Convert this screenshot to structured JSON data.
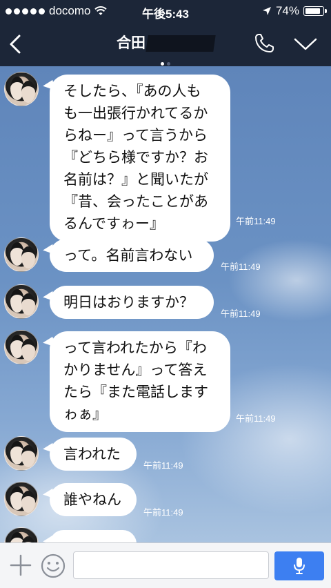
{
  "status_bar": {
    "carrier": "docomo",
    "time": "午後5:43",
    "battery": "74%",
    "battery_level": 0.74,
    "icons": [
      "signal-dots-icon",
      "wifi-icon",
      "location-arrow-icon",
      "battery-icon"
    ]
  },
  "header": {
    "title": "合田",
    "icons": [
      "back-chevron-icon",
      "phone-icon",
      "chevron-down-icon"
    ]
  },
  "messages": [
    {
      "text": "そしたら、『あの人もも一出張行かれてるからねー』って言うから『どちら様ですか？お名前は？』と聞いたが『昔、会ったことがあるんですゎー』",
      "lines": [
        "そしたら、『あの人も",
        "も一出張行かれてるか",
        "らねー』って言うから",
        "『どちら様ですか？お",
        "名前は？』と聞いたが",
        "『昔、会ったことがあ",
        "るんですゎー』"
      ],
      "time": "午前11:49"
    },
    {
      "text": "って。名前言わない",
      "lines": [
        "って。名前言わない"
      ],
      "time": "午前11:49"
    },
    {
      "text": "明日はおりますか？",
      "lines": [
        "明日はおりますか？"
      ],
      "time": "午前11:49"
    },
    {
      "text": "って言われたから『わかりません』って答えたら『また電話しますゎぁ』",
      "lines": [
        "って言われたから『わ",
        "かりません』って答え",
        "たら『また電話します",
        "ゎぁ』"
      ],
      "time": "午前11:49"
    },
    {
      "text": "言われた",
      "lines": [
        "言われた"
      ],
      "time": "午前11:49"
    },
    {
      "text": "誰やねん",
      "lines": [
        "誰やねん"
      ],
      "time": "午前11:49"
    }
  ],
  "input_bar": {
    "placeholder": "",
    "icons": [
      "plus-icon",
      "emoji-icon",
      "microphone-icon"
    ]
  },
  "colors": {
    "header_bg": "#1c2638",
    "chat_bg": "#6b92c4",
    "bubble_bg": "#ffffff",
    "mic_button": "#3d7ff1"
  }
}
